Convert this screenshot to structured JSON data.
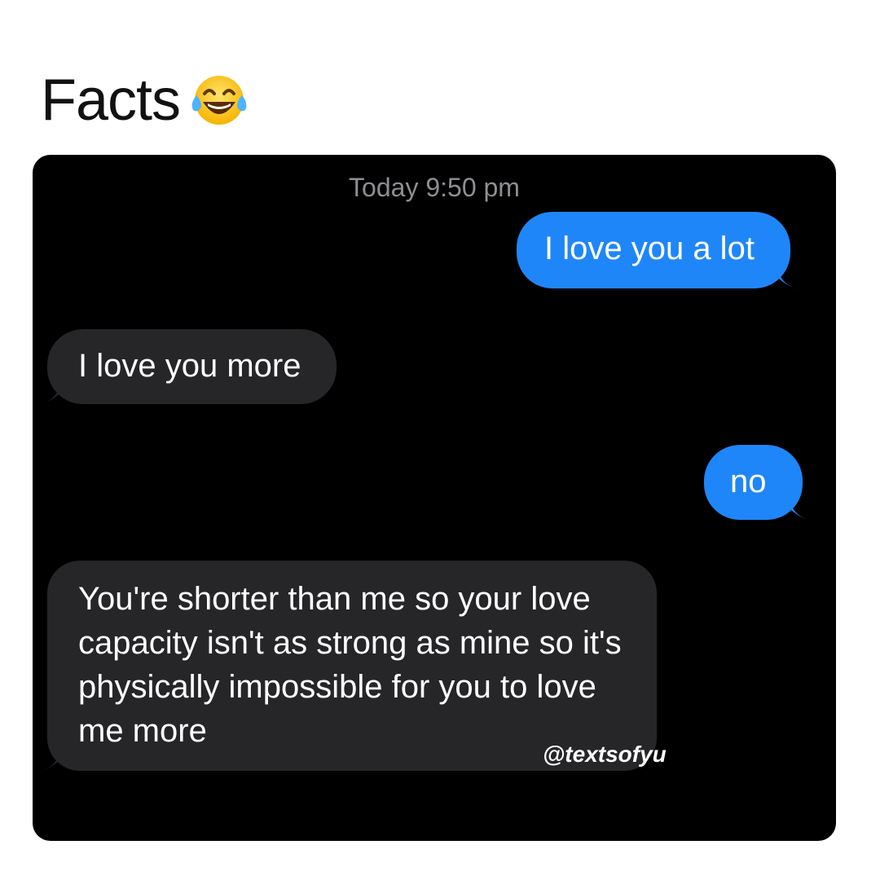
{
  "caption": {
    "title": "Facts",
    "emoji_icon": "face-with-tears-of-joy-icon"
  },
  "conversation": {
    "timestamp": "Today 9:50 pm",
    "messages": [
      {
        "sender": "me",
        "text": "I love you a lot"
      },
      {
        "sender": "other",
        "text": "I love you more"
      },
      {
        "sender": "me",
        "text": "no"
      },
      {
        "sender": "other",
        "text": "You're shorter than me so your love capacity isn't as strong as mine so it's physically impossible for you to love me more"
      }
    ]
  },
  "watermark": "@textsofyu",
  "colors": {
    "sent_bubble": "#1f86f9",
    "received_bubble": "#262528",
    "background": "#000000"
  }
}
